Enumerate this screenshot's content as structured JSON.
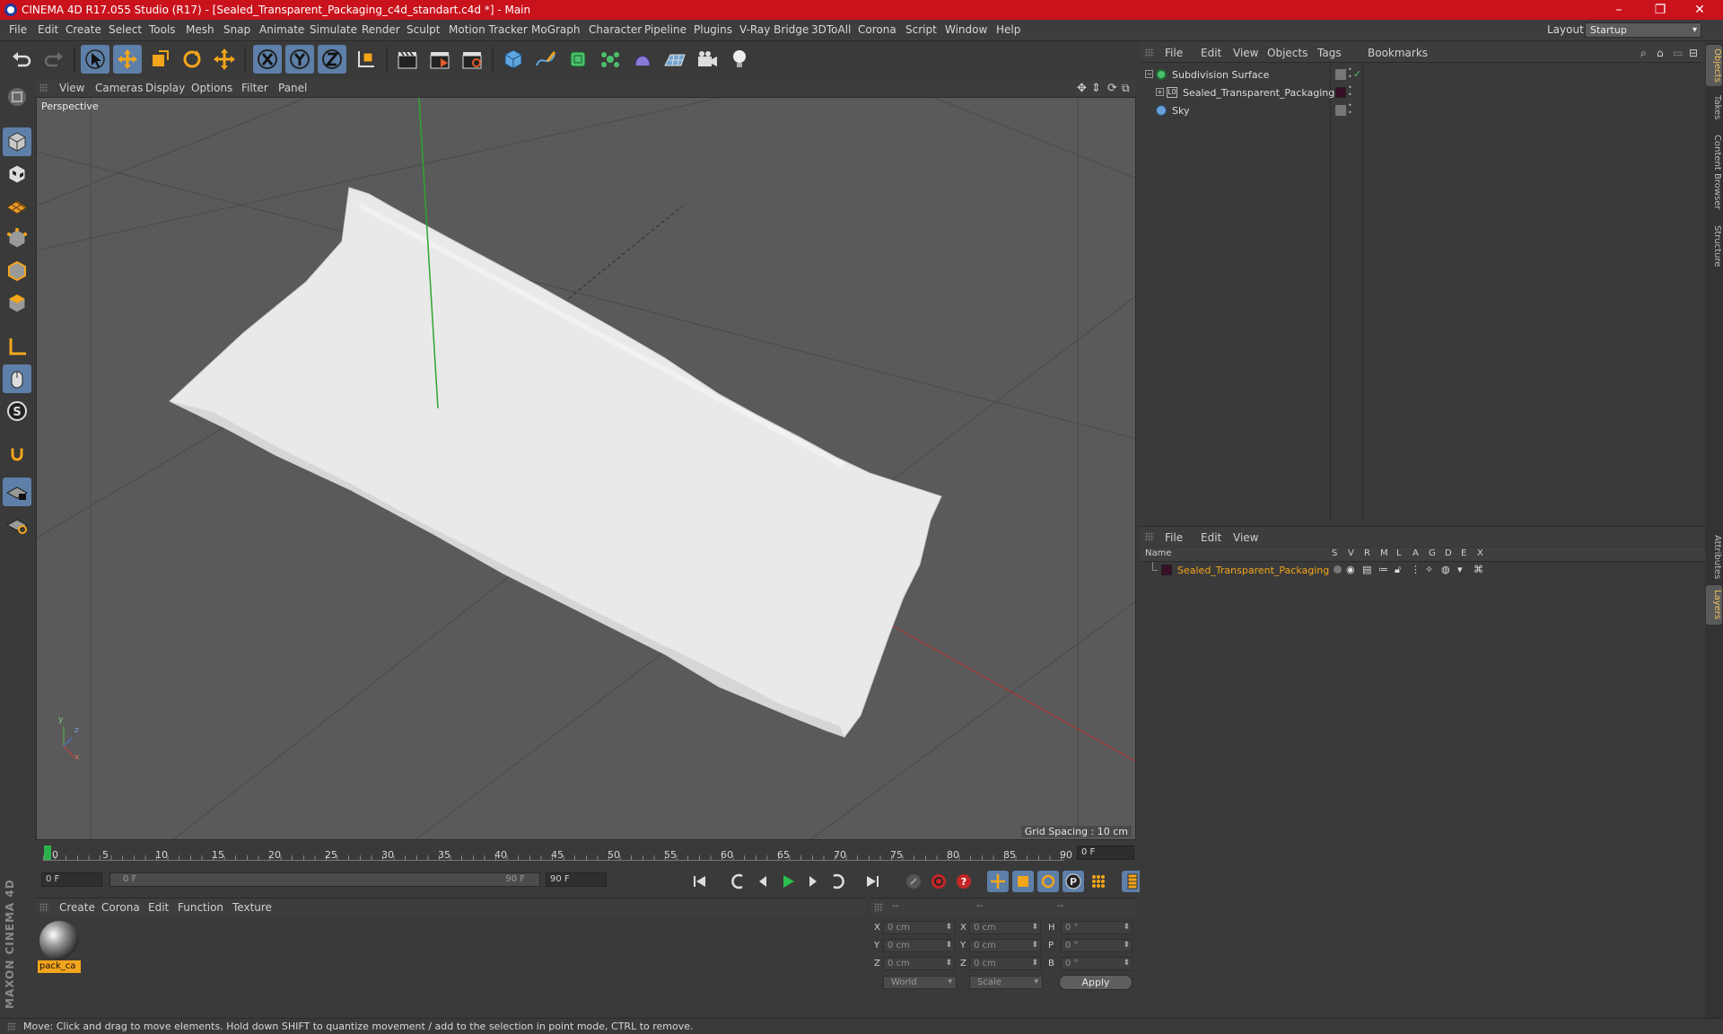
{
  "window": {
    "title": "CINEMA 4D R17.055 Studio (R17) - [Sealed_Transparent_Packaging_c4d_standart.c4d *] - Main",
    "minimize": "–",
    "maximize": "❐",
    "close": "✕"
  },
  "menu": [
    "File",
    "Edit",
    "Create",
    "Select",
    "Tools",
    "Mesh",
    "Snap",
    "Animate",
    "Simulate",
    "Render",
    "Sculpt",
    "Motion Tracker",
    "MoGraph",
    "Character",
    "Pipeline",
    "Plugins",
    "V-Ray Bridge",
    "3DToAll",
    "Corona",
    "Script",
    "Window",
    "Help"
  ],
  "layout": {
    "label": "Layout:",
    "value": "Startup"
  },
  "viewport": {
    "menu": [
      "View",
      "Cameras",
      "Display",
      "Options",
      "Filter",
      "Panel"
    ],
    "label": "Perspective",
    "grid_spacing": "Grid Spacing : 10 cm",
    "axis_x": "x",
    "axis_y": "y",
    "axis_z": "z"
  },
  "timeline": {
    "ticks": [
      "0",
      "5",
      "10",
      "15",
      "20",
      "25",
      "30",
      "35",
      "40",
      "45",
      "50",
      "55",
      "60",
      "65",
      "70",
      "75",
      "80",
      "85",
      "90"
    ],
    "current_frame": "0 F",
    "start_field": "0 F",
    "range_start": "0 F",
    "range_end": "90 F",
    "end_field": "90 F"
  },
  "material_manager": {
    "menu": [
      "Create",
      "Corona",
      "Edit",
      "Function",
      "Texture"
    ],
    "materials": [
      {
        "name": "pack_ca"
      }
    ]
  },
  "coordinates": {
    "headers": [
      "--",
      "--",
      "--"
    ],
    "rows": [
      {
        "a_label": "X",
        "a_value": "0 cm",
        "b_label": "X",
        "b_value": "0 cm",
        "c_label": "H",
        "c_value": "0 °"
      },
      {
        "a_label": "Y",
        "a_value": "0 cm",
        "b_label": "Y",
        "b_value": "0 cm",
        "c_label": "P",
        "c_value": "0 °"
      },
      {
        "a_label": "Z",
        "a_value": "0 cm",
        "b_label": "Z",
        "b_value": "0 cm",
        "c_label": "B",
        "c_value": "0 °"
      }
    ],
    "space": "World",
    "mode": "Scale",
    "apply": "Apply"
  },
  "object_manager": {
    "menu": [
      "File",
      "Edit",
      "View",
      "Objects",
      "Tags",
      "Bookmarks"
    ],
    "objects": [
      {
        "name": "Subdivision Surface"
      },
      {
        "name": "Sealed_Transparent_Packaging"
      },
      {
        "name": "Sky"
      }
    ]
  },
  "layer_manager": {
    "menu": [
      "File",
      "Edit",
      "View"
    ],
    "columns": [
      "Name",
      "S",
      "V",
      "R",
      "M",
      "L",
      "A",
      "G",
      "D",
      "E",
      "X"
    ],
    "layers": [
      {
        "name": "Sealed_Transparent_Packaging"
      }
    ]
  },
  "side_tabs": [
    "Objects",
    "Takes",
    "Content Browser",
    "Structure",
    "Attributes",
    "Layers"
  ],
  "status": "Move: Click and drag to move elements. Hold down SHIFT to quantize movement / add to the selection in point mode, CTRL to remove.",
  "branding": "MAXON CINEMA 4D",
  "colors": {
    "titlebar": "#c9121c",
    "active_tool": "#5d7fa8",
    "material_highlight": "#f3a51b",
    "layer_name": "#f3a51b"
  }
}
